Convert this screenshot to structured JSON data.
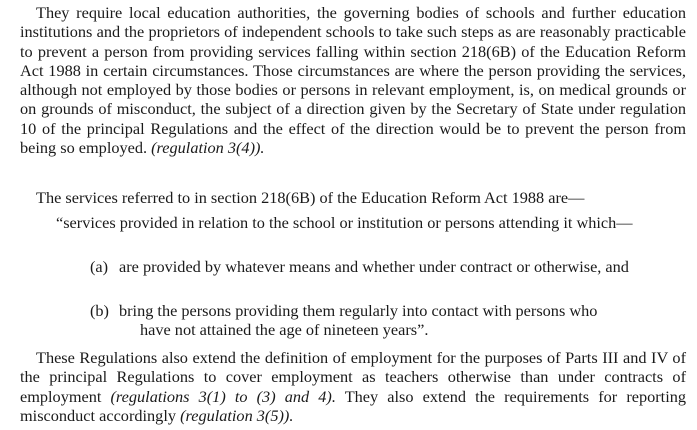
{
  "paragraph_1": {
    "text": "They require local education authorities, the governing bodies of schools and further education institutions and the proprietors of independent schools to take such steps as are reasonably practicable to prevent a person from providing services falling within section 218(6B) of the Education Reform Act 1988 in certain circumstances. Those circumstances are where the person providing the services, although not employed by those bodies or persons in relevant employment, is, on medical grounds or on grounds of misconduct, the subject of a direction given by the Secretary of State under regulation 10 of the principal Regulations and the effect of the direction would be to prevent the person from being so employed.",
    "reference": "(regulation 3(4))."
  },
  "paragraph_2": {
    "text": "The services referred to in section 218(6B) of the Education Reform Act 1988 are—"
  },
  "quote_intro": {
    "text": "“services provided in relation to the school or institution or persons attending it which—"
  },
  "items": [
    {
      "marker": "(a)",
      "text": "are provided by whatever means and whether under contract or otherwise, and"
    },
    {
      "marker": "(b)",
      "line_1": "bring the persons providing them regularly into contact with persons who",
      "line_2": "have not attained the age of nineteen years”."
    }
  ],
  "paragraph_4": {
    "text_1": "These Regulations also extend the definition of employment for the purposes of Parts III and IV of the principal Regulations to cover employment as teachers otherwise than under contracts of employment",
    "reference_1": "(regulations 3(1) to (3) and 4).",
    "text_2": "They also extend the requirements for reporting misconduct accordingly",
    "reference_2": "(regulation 3(5))."
  }
}
